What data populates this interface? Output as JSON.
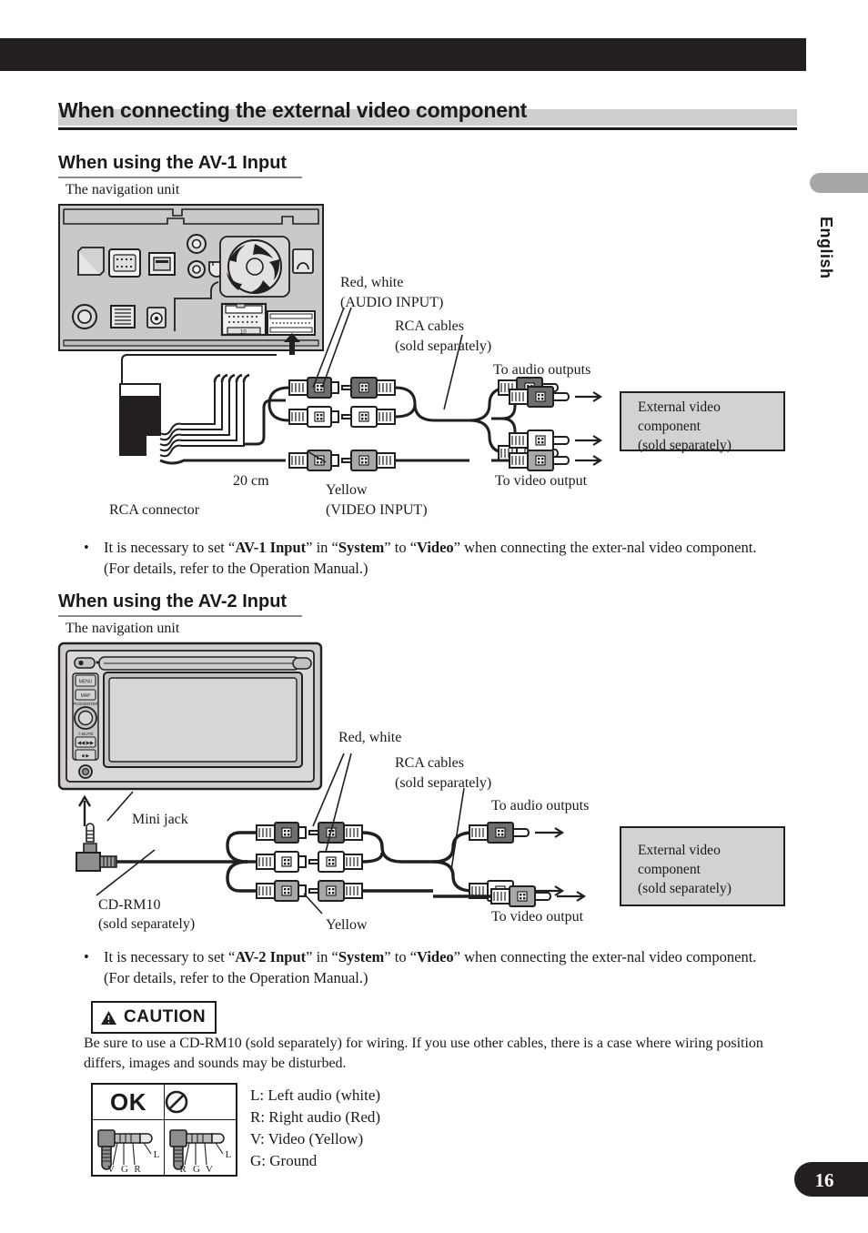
{
  "page": {
    "number": "16",
    "language_tab": "English"
  },
  "section_title": "When connecting the external video component",
  "av1": {
    "heading": "When using the AV-1 Input",
    "unit_caption": "The navigation unit",
    "labels": {
      "red_white": "Red, white",
      "audio_input": "(AUDIO INPUT)",
      "rca_cables": "RCA cables",
      "sold_separately": "(sold separately)",
      "to_audio_outputs": "To audio outputs",
      "to_video_output": "To video output",
      "yellow": "Yellow",
      "video_input": "(VIDEO INPUT)",
      "length": "20 cm",
      "rca_connector": "RCA connector"
    },
    "external_box": {
      "line1": "External video",
      "line2": "component",
      "line3": "(sold separately)"
    },
    "note": {
      "bullet": "•",
      "t1": "It is necessary to set “",
      "b1": "AV-1 Input",
      "t2": "” in “",
      "b2": "System",
      "t3": "” to “",
      "b3": "Video",
      "t4": "” when connecting the exter-nal video component. (For details, refer to the Operation Manual.)"
    }
  },
  "av2": {
    "heading": "When using the AV-2 Input",
    "unit_caption": "The navigation unit",
    "labels": {
      "mini_jack": "Mini jack",
      "cd_rm10": "CD-RM10",
      "sold_separately_cd": "(sold separately)",
      "red_white": "Red, white",
      "rca_cables": "RCA cables",
      "sold_separately": "(sold separately)",
      "to_audio_outputs": "To audio outputs",
      "to_video_output": "To video output",
      "yellow": "Yellow"
    },
    "external_box": {
      "line1": "External video",
      "line2": "component",
      "line3": "(sold separately)"
    },
    "note": {
      "bullet": "•",
      "t1": "It is necessary to set “",
      "b1": "AV-2 Input",
      "t2": "” in “",
      "b2": "System",
      "t3": "” to “",
      "b3": "Video",
      "t4": "” when connecting the exter-nal video component. (For details, refer to the Operation Manual.)"
    }
  },
  "caution": {
    "label": "CAUTION",
    "warning_icon": "warning-triangle-icon",
    "body": "Be sure to use a CD-RM10 (sold separately) for wiring. If you use other cables, there is a case where wiring position differs, images and sounds may be disturbed."
  },
  "plug_table": {
    "ok_label": "OK",
    "ng_label": "prohibited-icon",
    "ok_pins": [
      "V",
      "G",
      "R"
    ],
    "ok_tip": "L",
    "ng_pins": [
      "R",
      "G",
      "V"
    ],
    "ng_tip": "L",
    "legend": [
      "L: Left audio (white)",
      "R: Right audio (Red)",
      "V: Video (Yellow)",
      "G: Ground"
    ]
  },
  "colors": {
    "black": "#231f20",
    "band_gray": "#cfcfcf",
    "panel_gray": "#c9c9c9",
    "box_gray": "#d2d2d2",
    "dark_plug": "#6e6e6e",
    "mid_plug": "#a8a8a8",
    "white_plug": "#ffffff"
  }
}
